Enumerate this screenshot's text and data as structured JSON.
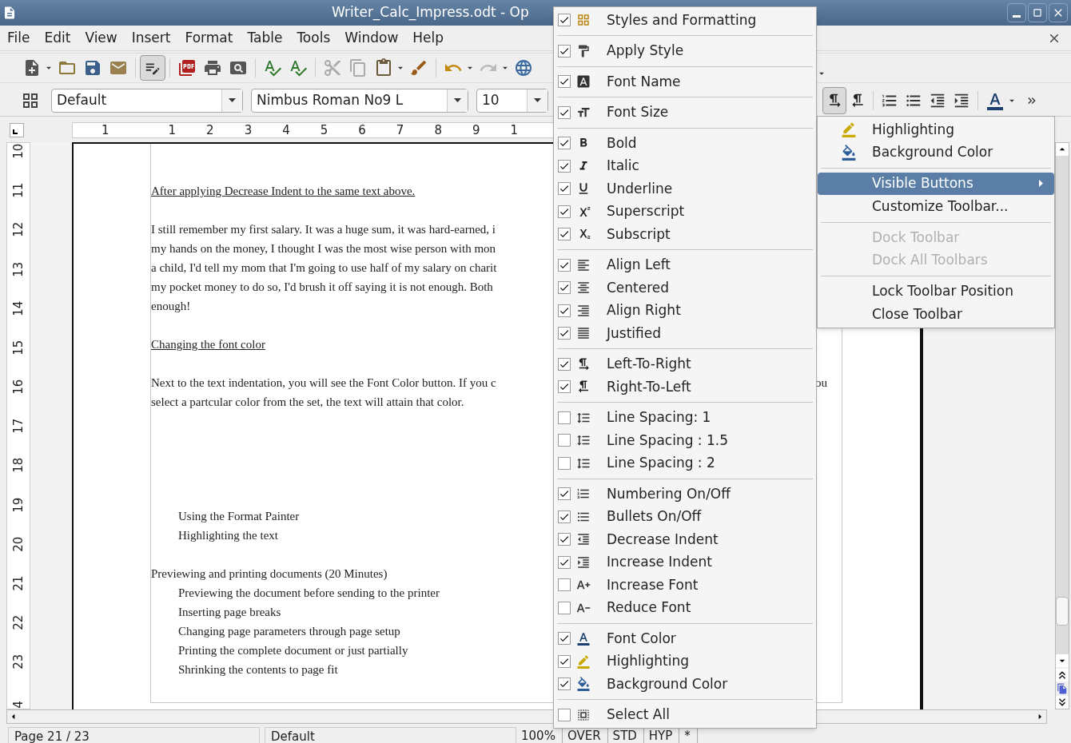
{
  "window": {
    "title": "Writer_Calc_Impress.odt - Op"
  },
  "menu_bar": [
    "File",
    "Edit",
    "View",
    "Insert",
    "Format",
    "Table",
    "Tools",
    "Window",
    "Help"
  ],
  "formatting_toolbar": {
    "style": "Default",
    "font": "Nimbus Roman No9 L",
    "size": "10"
  },
  "horizontal_ruler": [
    "1",
    "1",
    "2",
    "3",
    "4",
    "5",
    "6",
    "7",
    "8",
    "9",
    "1"
  ],
  "vertical_ruler": [
    "10",
    "11",
    "12",
    "13",
    "14",
    "15",
    "16",
    "17",
    "18",
    "19",
    "20",
    "21",
    "22",
    "23",
    "4"
  ],
  "document": {
    "sections": [
      {
        "paragraphs": [
          {
            "kind": "heading",
            "lines": [
              {
                "text": "After applying Decrease Indent to the same text above."
              }
            ]
          },
          {
            "kind": "body",
            "lines": [
              {
                "text": "I still remember my first salary. It was a huge sum, it was hard-earned, i"
              },
              {
                "text": "my hands on the money, I thought I was the most wise person with mon"
              },
              {
                "text": "a child, I'd tell my mom that I'm going to use half of my salary on charit"
              },
              {
                "text": "my pocket money to do so, I'd brush it off saying it is not enough. Both"
              },
              {
                "text": "enough!"
              }
            ]
          },
          {
            "kind": "heading",
            "lines": [
              {
                "text": "Changing the font color"
              }
            ]
          },
          {
            "kind": "body",
            "lines": [
              {
                "text": "Next to the text indentation, you will see the Font Color button. If you c",
                "tail": "ou"
              },
              {
                "text": "select a partcular color from the set, the text will attain that color."
              }
            ]
          }
        ]
      },
      {
        "paragraphs": [
          {
            "kind": "subitem",
            "lines": [
              {
                "text": "Using the Format Painter"
              },
              {
                "text": "Highlighting the text"
              }
            ]
          },
          {
            "kind": "body",
            "lines": [
              {
                "text": "Previewing and printing documents (20 Minutes)"
              }
            ]
          },
          {
            "kind": "subitem",
            "lines": [
              {
                "text": "Previewing the document before sending to the printer"
              },
              {
                "text": "Inserting page breaks"
              },
              {
                "text": "Changing page parameters through page setup"
              },
              {
                "text": "Printing the complete document or just partially"
              },
              {
                "text": "Shrinking the contents to page fit"
              }
            ]
          }
        ]
      }
    ]
  },
  "status_bar": [
    {
      "kind": "field",
      "text": "Page 21 / 23"
    },
    {
      "kind": "field",
      "text": "Default"
    },
    {
      "kind": "cell",
      "text": "100%"
    },
    {
      "kind": "cell",
      "text": "OVER"
    },
    {
      "kind": "cell",
      "text": "STD"
    },
    {
      "kind": "cell",
      "text": "HYP"
    },
    {
      "kind": "cell",
      "text": "*"
    }
  ],
  "visible_buttons_menu": {
    "groups": [
      [
        {
          "label": "Styles and Formatting",
          "checked": true
        }
      ],
      [
        {
          "label": "Apply Style",
          "checked": true
        }
      ],
      [
        {
          "label": "Font Name",
          "checked": true
        }
      ],
      [
        {
          "label": "Font Size",
          "checked": true
        }
      ],
      [
        {
          "label": "Bold",
          "checked": true
        },
        {
          "label": "Italic",
          "checked": true
        },
        {
          "label": "Underline",
          "checked": true
        },
        {
          "label": "Superscript",
          "checked": true
        },
        {
          "label": "Subscript",
          "checked": true
        }
      ],
      [
        {
          "label": "Align Left",
          "checked": true
        },
        {
          "label": "Centered",
          "checked": true
        },
        {
          "label": "Align Right",
          "checked": true
        },
        {
          "label": "Justified",
          "checked": true
        }
      ],
      [
        {
          "label": "Left-To-Right",
          "checked": true
        },
        {
          "label": "Right-To-Left",
          "checked": true
        }
      ],
      [
        {
          "label": "Line Spacing: 1",
          "checked": false
        },
        {
          "label": "Line Spacing : 1.5",
          "checked": false
        },
        {
          "label": "Line Spacing : 2",
          "checked": false
        }
      ],
      [
        {
          "label": "Numbering On/Off",
          "checked": true
        },
        {
          "label": "Bullets On/Off",
          "checked": true
        },
        {
          "label": "Decrease Indent",
          "checked": true
        },
        {
          "label": "Increase Indent",
          "checked": true
        },
        {
          "label": "Increase Font",
          "checked": false
        },
        {
          "label": "Reduce Font",
          "checked": false
        }
      ],
      [
        {
          "label": "Font Color",
          "checked": true
        },
        {
          "label": "Highlighting",
          "checked": true
        },
        {
          "label": "Background Color",
          "checked": true
        }
      ],
      [
        {
          "label": "Select All",
          "checked": false
        }
      ]
    ]
  },
  "context_menu": {
    "groups": [
      [
        {
          "label": "Highlighting",
          "highlighted": false,
          "disabled": false
        },
        {
          "label": "Background Color",
          "highlighted": false,
          "disabled": false
        }
      ],
      [
        {
          "label": "Visible Buttons",
          "highlighted": true,
          "disabled": false,
          "submenu": true
        },
        {
          "label": "Customize Toolbar...",
          "highlighted": false,
          "disabled": false
        }
      ],
      [
        {
          "label": "Dock Toolbar",
          "highlighted": false,
          "disabled": true
        },
        {
          "label": "Dock All Toolbars",
          "highlighted": false,
          "disabled": true
        }
      ],
      [
        {
          "label": "Lock Toolbar Position",
          "highlighted": false,
          "disabled": false
        },
        {
          "label": "Close Toolbar",
          "highlighted": false,
          "disabled": false
        }
      ]
    ]
  }
}
